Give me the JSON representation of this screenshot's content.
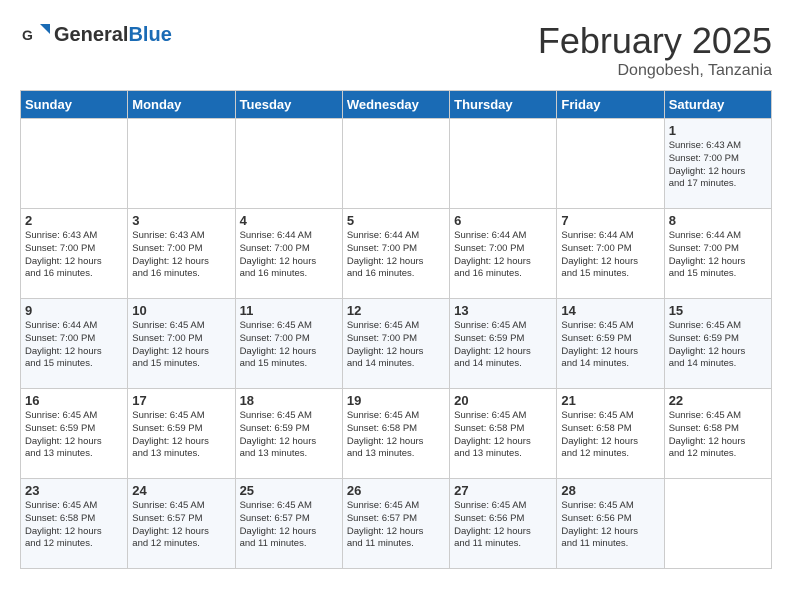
{
  "header": {
    "logo_line1": "General",
    "logo_line2": "Blue",
    "month_title": "February 2025",
    "subtitle": "Dongobesh, Tanzania"
  },
  "days_of_week": [
    "Sunday",
    "Monday",
    "Tuesday",
    "Wednesday",
    "Thursday",
    "Friday",
    "Saturday"
  ],
  "weeks": [
    [
      {
        "day": "",
        "info": ""
      },
      {
        "day": "",
        "info": ""
      },
      {
        "day": "",
        "info": ""
      },
      {
        "day": "",
        "info": ""
      },
      {
        "day": "",
        "info": ""
      },
      {
        "day": "",
        "info": ""
      },
      {
        "day": "1",
        "info": "Sunrise: 6:43 AM\nSunset: 7:00 PM\nDaylight: 12 hours\nand 17 minutes."
      }
    ],
    [
      {
        "day": "2",
        "info": "Sunrise: 6:43 AM\nSunset: 7:00 PM\nDaylight: 12 hours\nand 16 minutes."
      },
      {
        "day": "3",
        "info": "Sunrise: 6:43 AM\nSunset: 7:00 PM\nDaylight: 12 hours\nand 16 minutes."
      },
      {
        "day": "4",
        "info": "Sunrise: 6:44 AM\nSunset: 7:00 PM\nDaylight: 12 hours\nand 16 minutes."
      },
      {
        "day": "5",
        "info": "Sunrise: 6:44 AM\nSunset: 7:00 PM\nDaylight: 12 hours\nand 16 minutes."
      },
      {
        "day": "6",
        "info": "Sunrise: 6:44 AM\nSunset: 7:00 PM\nDaylight: 12 hours\nand 16 minutes."
      },
      {
        "day": "7",
        "info": "Sunrise: 6:44 AM\nSunset: 7:00 PM\nDaylight: 12 hours\nand 15 minutes."
      },
      {
        "day": "8",
        "info": "Sunrise: 6:44 AM\nSunset: 7:00 PM\nDaylight: 12 hours\nand 15 minutes."
      }
    ],
    [
      {
        "day": "9",
        "info": "Sunrise: 6:44 AM\nSunset: 7:00 PM\nDaylight: 12 hours\nand 15 minutes."
      },
      {
        "day": "10",
        "info": "Sunrise: 6:45 AM\nSunset: 7:00 PM\nDaylight: 12 hours\nand 15 minutes."
      },
      {
        "day": "11",
        "info": "Sunrise: 6:45 AM\nSunset: 7:00 PM\nDaylight: 12 hours\nand 15 minutes."
      },
      {
        "day": "12",
        "info": "Sunrise: 6:45 AM\nSunset: 7:00 PM\nDaylight: 12 hours\nand 14 minutes."
      },
      {
        "day": "13",
        "info": "Sunrise: 6:45 AM\nSunset: 6:59 PM\nDaylight: 12 hours\nand 14 minutes."
      },
      {
        "day": "14",
        "info": "Sunrise: 6:45 AM\nSunset: 6:59 PM\nDaylight: 12 hours\nand 14 minutes."
      },
      {
        "day": "15",
        "info": "Sunrise: 6:45 AM\nSunset: 6:59 PM\nDaylight: 12 hours\nand 14 minutes."
      }
    ],
    [
      {
        "day": "16",
        "info": "Sunrise: 6:45 AM\nSunset: 6:59 PM\nDaylight: 12 hours\nand 13 minutes."
      },
      {
        "day": "17",
        "info": "Sunrise: 6:45 AM\nSunset: 6:59 PM\nDaylight: 12 hours\nand 13 minutes."
      },
      {
        "day": "18",
        "info": "Sunrise: 6:45 AM\nSunset: 6:59 PM\nDaylight: 12 hours\nand 13 minutes."
      },
      {
        "day": "19",
        "info": "Sunrise: 6:45 AM\nSunset: 6:58 PM\nDaylight: 12 hours\nand 13 minutes."
      },
      {
        "day": "20",
        "info": "Sunrise: 6:45 AM\nSunset: 6:58 PM\nDaylight: 12 hours\nand 13 minutes."
      },
      {
        "day": "21",
        "info": "Sunrise: 6:45 AM\nSunset: 6:58 PM\nDaylight: 12 hours\nand 12 minutes."
      },
      {
        "day": "22",
        "info": "Sunrise: 6:45 AM\nSunset: 6:58 PM\nDaylight: 12 hours\nand 12 minutes."
      }
    ],
    [
      {
        "day": "23",
        "info": "Sunrise: 6:45 AM\nSunset: 6:58 PM\nDaylight: 12 hours\nand 12 minutes."
      },
      {
        "day": "24",
        "info": "Sunrise: 6:45 AM\nSunset: 6:57 PM\nDaylight: 12 hours\nand 12 minutes."
      },
      {
        "day": "25",
        "info": "Sunrise: 6:45 AM\nSunset: 6:57 PM\nDaylight: 12 hours\nand 11 minutes."
      },
      {
        "day": "26",
        "info": "Sunrise: 6:45 AM\nSunset: 6:57 PM\nDaylight: 12 hours\nand 11 minutes."
      },
      {
        "day": "27",
        "info": "Sunrise: 6:45 AM\nSunset: 6:56 PM\nDaylight: 12 hours\nand 11 minutes."
      },
      {
        "day": "28",
        "info": "Sunrise: 6:45 AM\nSunset: 6:56 PM\nDaylight: 12 hours\nand 11 minutes."
      },
      {
        "day": "",
        "info": ""
      }
    ]
  ]
}
